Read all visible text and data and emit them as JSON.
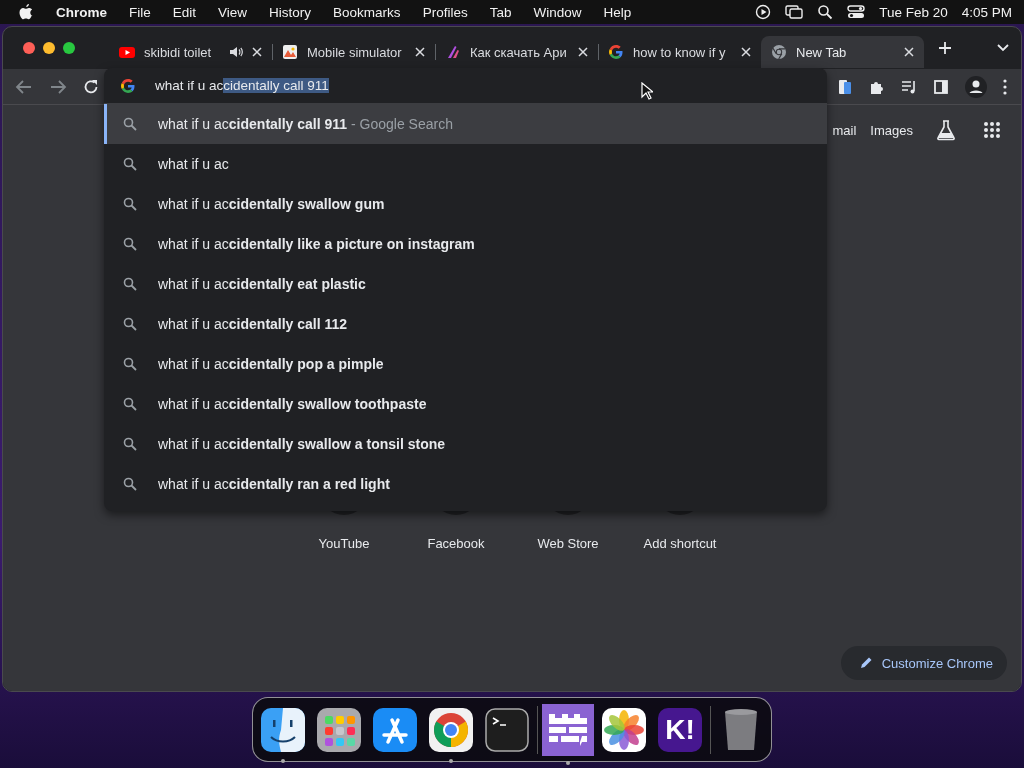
{
  "menu_bar": {
    "app": "Chrome",
    "menus": [
      "File",
      "Edit",
      "View",
      "History",
      "Bookmarks",
      "Profiles",
      "Tab",
      "Window",
      "Help"
    ],
    "date": "Tue Feb 20",
    "time": "4:05 PM"
  },
  "tabs": [
    {
      "title": "skibidi toilet",
      "kind": "youtube",
      "audio": true,
      "selected": false
    },
    {
      "title": "Mobile simulator",
      "kind": "picture",
      "audio": false,
      "selected": false
    },
    {
      "title": "Как скачать Ари",
      "kind": "stroke",
      "audio": false,
      "selected": false
    },
    {
      "title": "how to know if y",
      "kind": "google",
      "audio": false,
      "selected": false
    },
    {
      "title": "New Tab",
      "kind": "chrome",
      "audio": false,
      "selected": true
    }
  ],
  "omnibox": {
    "typed": "what if u ac",
    "completion": "cidentally call 911"
  },
  "suggestions": [
    {
      "text": "what if u ac**cidentally call 911**",
      "suffix": "- Google Search",
      "selected": true
    },
    {
      "text": "what if u ac",
      "selected": false
    },
    {
      "text": "what if u ac**cidentally swallow gum**",
      "selected": false
    },
    {
      "text": "what if u ac**cidentally like a picture on instagram**",
      "selected": false
    },
    {
      "text": "what if u ac**cidentally eat plastic**",
      "selected": false
    },
    {
      "text": "what if u ac**cidentally call 112**",
      "selected": false
    },
    {
      "text": "what if u ac**cidentally pop a pimple**",
      "selected": false
    },
    {
      "text": "what if u ac**cidentally swallow toothpaste**",
      "selected": false
    },
    {
      "text": "what if u ac**cidentally swallow a tonsil stone**",
      "selected": false
    },
    {
      "text": "what if u ac**cidentally ran a red light**",
      "selected": false
    }
  ],
  "page": {
    "links": [
      "mail",
      "Images"
    ],
    "shortcuts": [
      "YouTube",
      "Facebook",
      "Web Store",
      "Add shortcut"
    ],
    "customize_button": "Customize Chrome"
  },
  "dock": {
    "groups": [
      {
        "items": [
          {
            "kind": "finder",
            "running": true
          },
          {
            "kind": "launchpad",
            "running": false
          },
          {
            "kind": "app-store",
            "running": false
          },
          {
            "kind": "chrome",
            "running": true
          },
          {
            "kind": "terminal",
            "running": false
          }
        ]
      },
      {
        "items": [
          {
            "kind": "wall",
            "running": true
          },
          {
            "kind": "photos",
            "running": false
          },
          {
            "kind": "kahoot",
            "label": "K!",
            "running": false
          }
        ]
      },
      {
        "items": [
          {
            "kind": "trash",
            "running": false
          }
        ]
      }
    ]
  }
}
